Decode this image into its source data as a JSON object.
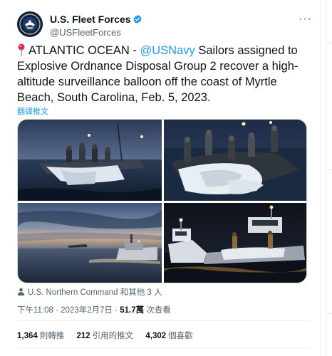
{
  "author": {
    "display_name": "U.S. Fleet Forces",
    "handle": "@USFleetForces"
  },
  "more_label": "···",
  "tweet": {
    "text_before": "ATLANTIC OCEAN - ",
    "mention": "@USNavy",
    "text_after": " Sailors assigned to Explosive Ordnance Disposal Group 2 recover a high-altitude surveillance balloon off the coast of Myrtle Beach, South Carolina, Feb. 5, 2023.",
    "translate_label": "翻譯推文"
  },
  "tagged": "U.S. Northern Command 和其他 3 人",
  "meta": {
    "timestamp": "下午11:08 · 2023年2月7日 · ",
    "views_count": "51.7萬",
    "views_label": " 次查看"
  },
  "stats": {
    "retweets_count": "1,364",
    "retweets_label": "則轉推",
    "quotes_count": "212",
    "quotes_label": "引用的推文",
    "likes_count": "4,302",
    "likes_label": "個喜歡"
  },
  "colors": {
    "link": "#1d9bf0",
    "verified": "#1d9bf0",
    "secondary_text": "#536471"
  }
}
